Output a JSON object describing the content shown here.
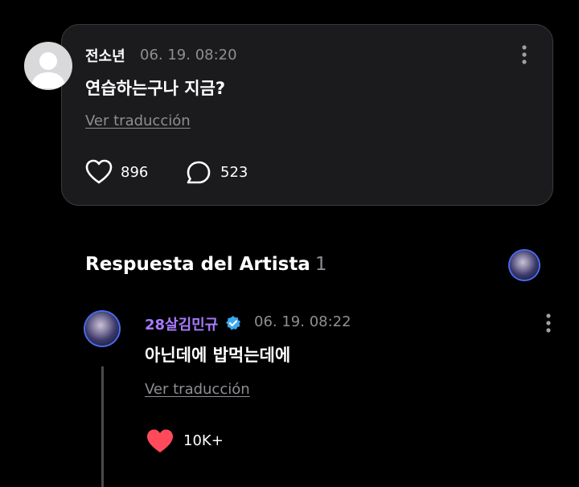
{
  "post": {
    "author": "전소년",
    "timestamp": "06. 19. 08:20",
    "body": "연습하는구나 지금?",
    "translate_label": "Ver traducción",
    "likes": "896",
    "comments": "523",
    "more_icon": "kebab-vertical-icon",
    "like_icon": "heart-outline-icon",
    "comment_icon": "chat-bubble-icon"
  },
  "section": {
    "title": "Respuesta del Artista",
    "count": "1"
  },
  "reply": {
    "author": "28살김민규",
    "verified": true,
    "timestamp": "06. 19. 08:22",
    "body": "아닌데에 밥먹는데에",
    "translate_label": "Ver traducción",
    "likes": "10K+",
    "like_icon": "heart-filled-icon"
  },
  "colors": {
    "background": "#000000",
    "card": "#1b1b1d",
    "artist_name": "#a77bff",
    "verified": "#3aa8f0",
    "heart": "#ff4a5c",
    "muted": "#8e8e93"
  }
}
